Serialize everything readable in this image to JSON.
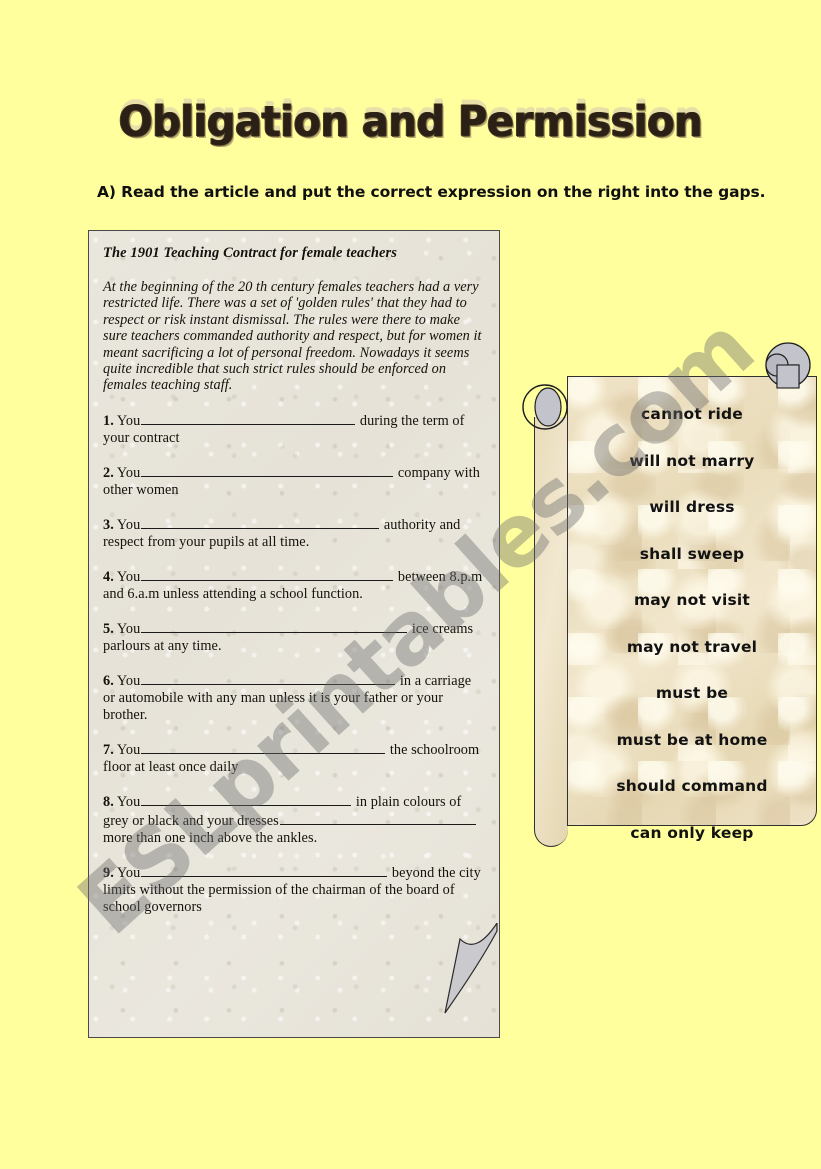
{
  "colors": {
    "page_background": "#ffff9e",
    "article_paper": "#e7e3da",
    "scroll_paper": "#eddfc0",
    "title_text": "#2b2016",
    "title_shadow": "#e8e0a8",
    "curl_gray": "#c3c3cb",
    "watermark": "#6e6e6e"
  },
  "watermark": {
    "text": "ESLprintables.com"
  },
  "header": {
    "title": "Obligation and Permission"
  },
  "instruction": {
    "text": "A) Read the article and put the correct expression on the right into the gaps."
  },
  "article": {
    "heading": "The 1901 Teaching Contract for female teachers",
    "intro": "At the beginning of the 20 th century females teachers had a very restricted life. There was a set of 'golden rules' that they had to respect or risk instant dismissal. The rules were there to make sure teachers commanded authority and respect, but for women it meant sacrificing a lot of personal freedom. Nowadays it seems quite incredible that such strict rules should be enforced on females teaching staff.",
    "questions": [
      {
        "number": "1.",
        "lead": "You",
        "gap_width": 214,
        "tail": "during the term of your contract"
      },
      {
        "number": "2.",
        "lead": "You",
        "gap_width": 252,
        "tail": "company with other women"
      },
      {
        "number": "3.",
        "lead": "You",
        "gap_width": 238,
        "tail": "authority and respect from your pupils at all time."
      },
      {
        "number": "4.",
        "lead": "You",
        "gap_width": 252,
        "tail": "between 8.p.m and 6.a.m unless attending a school function."
      },
      {
        "number": "5.",
        "lead": "You",
        "gap_width": 266,
        "tail": "ice creams parlours at any time."
      },
      {
        "number": "6.",
        "lead": "You",
        "gap_width": 254,
        "tail": "in a carriage or automobile with any man unless it is your father or your brother."
      },
      {
        "number": "7.",
        "lead": "You",
        "gap_width": 244,
        "tail": "the schoolroom floor at least once daily"
      },
      {
        "number": "8.",
        "lead": "You",
        "gap_width": 210,
        "tail": "in plain colours of grey or black and your dresses",
        "gap2_width": 196,
        "tail2": "more than one inch above the ankles."
      },
      {
        "number": "9.",
        "lead": "You",
        "gap_width": 246,
        "tail": "beyond the city limits without the permission of the chairman of the board of school governors"
      }
    ]
  },
  "answers": {
    "items": [
      "cannot ride",
      "will not marry",
      "will dress",
      "shall sweep",
      "may not visit",
      "may not travel",
      "must be",
      "must be at home",
      "should command",
      "can only keep"
    ]
  }
}
